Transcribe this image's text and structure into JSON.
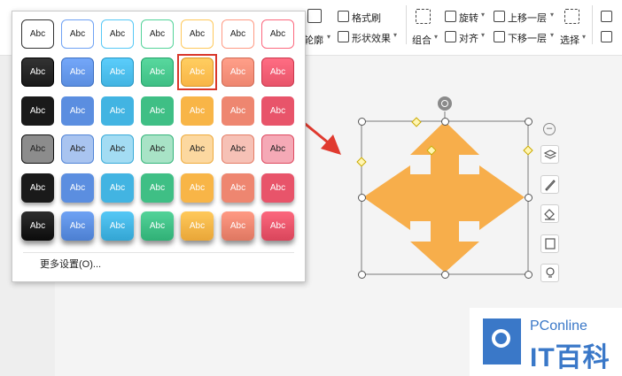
{
  "ribbon": {
    "outline_label": "轮廓",
    "format_painter_label": "格式刷",
    "shape_effect_label": "形状效果",
    "group_label": "组合",
    "rotate_label": "旋转",
    "align_label": "对齐",
    "bring_forward_label": "上移一层",
    "send_backward_label": "下移一层",
    "select_label": "选择"
  },
  "gallery": {
    "swatch_text": "Abc",
    "more_settings_label": "更多设置(O)...",
    "selected_row": 1,
    "selected_col": 4,
    "colors": [
      "#1a1a1a",
      "#5b8ee0",
      "#42b4e2",
      "#3fbf85",
      "#f8b547",
      "#ee8670",
      "#e8546a"
    ],
    "colors_light": [
      "#8c8c8c",
      "#a9c4f0",
      "#a3dcf3",
      "#a8e3c6",
      "#fcd8a0",
      "#f6c1b6",
      "#f5a9b6"
    ]
  },
  "shape": {
    "fill": "#f7ae4b",
    "name": "cross-arrow"
  },
  "annotation": {
    "arrow_color": "#e03a2f"
  },
  "side_tools": [
    "collapse-icon",
    "layers-icon",
    "pen-icon",
    "fill-icon",
    "outline-icon",
    "bulb-icon"
  ],
  "watermark": {
    "line1": "PConline",
    "line2": "IT百科"
  }
}
